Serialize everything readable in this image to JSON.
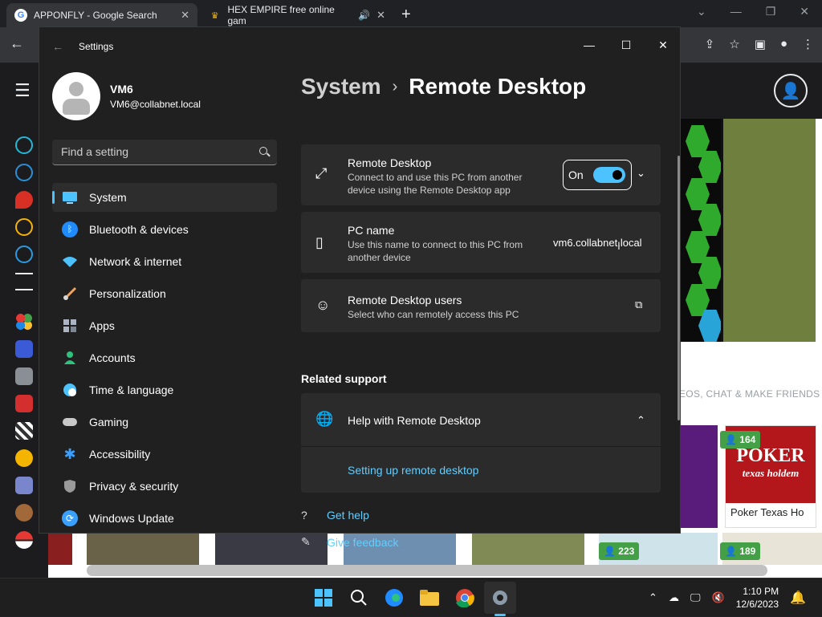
{
  "browser": {
    "tabs": [
      {
        "title": "APPONFLY - Google Search",
        "favicon": "G"
      },
      {
        "title": "HEX EMPIRE free online gam",
        "favicon": "♛"
      }
    ],
    "new_tab_label": "+"
  },
  "website": {
    "chat_banner": "EOS, CHAT & MAKE FRIENDS",
    "cards": [
      {
        "name": "Poker Texas Ho",
        "players": "164",
        "image_text": "POKER",
        "image_subtext": "texas holdem"
      }
    ],
    "bottom_badges": [
      "223",
      "189"
    ]
  },
  "settings": {
    "window_title": "Settings",
    "user": {
      "name": "VM6",
      "email": "VM6@collabnet.local"
    },
    "search_placeholder": "Find a setting",
    "nav": [
      {
        "label": "System",
        "icon": "monitor-icon",
        "color": "#4cc2ff",
        "active": true
      },
      {
        "label": "Bluetooth & devices",
        "icon": "bluetooth-icon",
        "color": "#1f8bff"
      },
      {
        "label": "Network & internet",
        "icon": "wifi-icon",
        "color": "#4cc2ff"
      },
      {
        "label": "Personalization",
        "icon": "brush-icon",
        "color": "#f0a35a"
      },
      {
        "label": "Apps",
        "icon": "apps-icon",
        "color": "#aab4c2"
      },
      {
        "label": "Accounts",
        "icon": "person-icon",
        "color": "#2ec27e"
      },
      {
        "label": "Time & language",
        "icon": "globe-clock-icon",
        "color": "#4cc2ff"
      },
      {
        "label": "Gaming",
        "icon": "gamepad-icon",
        "color": "#c8c8c8"
      },
      {
        "label": "Accessibility",
        "icon": "accessibility-icon",
        "color": "#3aa0ff"
      },
      {
        "label": "Privacy & security",
        "icon": "shield-icon",
        "color": "#9a9a9a"
      },
      {
        "label": "Windows Update",
        "icon": "refresh-icon",
        "color": "#3aa0ff"
      }
    ],
    "breadcrumb": {
      "parent": "System",
      "separator": "›",
      "current": "Remote Desktop"
    },
    "remote_desktop": {
      "title": "Remote Desktop",
      "description": "Connect to and use this PC from another device using the Remote Desktop app",
      "toggle_label": "On",
      "toggle_on": true
    },
    "pc_name": {
      "title": "PC name",
      "description": "Use this name to connect to this PC from another device",
      "value": "vm6.collabnet.local"
    },
    "rd_users": {
      "title": "Remote Desktop users",
      "description": "Select who can remotely access this PC"
    },
    "related_support": {
      "heading": "Related support",
      "help_title": "Help with Remote Desktop",
      "help_link": "Setting up remote desktop"
    },
    "footer": {
      "get_help": "Get help",
      "give_feedback": "Give feedback"
    }
  },
  "taskbar": {
    "time": "1:10 PM",
    "date": "12/6/2023"
  }
}
